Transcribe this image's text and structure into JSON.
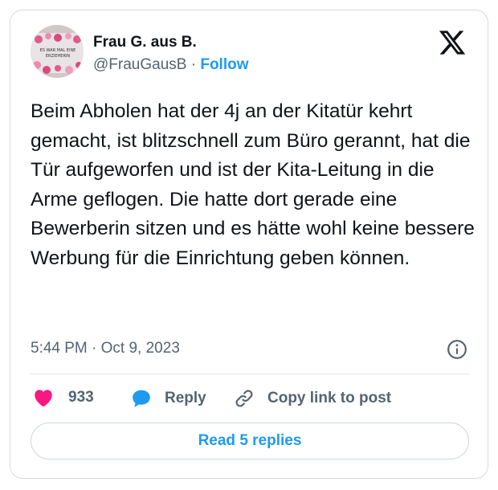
{
  "author": {
    "name": "Frau G. aus B.",
    "handle": "@FrauGausB",
    "separator": "·",
    "follow_label": "Follow",
    "avatar_caption_line1": "ES WAR MAL EINE",
    "avatar_caption_line2": "ERZIEHERIN"
  },
  "tweet": {
    "text": "Beim Abholen hat der 4j an der Kitatür kehrt gemacht, ist blitzschnell zum Büro gerannt, hat die Tür aufgeworfen und ist der Kita-Leitung in die Arme geflogen. Die hatte dort gerade eine Bewerberin sitzen und es hätte wohl keine bessere Werbung für die Einrichtung geben können.",
    "time": "5:44 PM",
    "separator": "·",
    "date": "Oct 9, 2023"
  },
  "actions": {
    "like_count": "933",
    "reply_label": "Reply",
    "copy_label": "Copy link to post"
  },
  "footer": {
    "read_replies_label": "Read 5 replies"
  },
  "colors": {
    "accent": "#1d9bf0",
    "like": "#f91880",
    "text": "#0f1419",
    "muted": "#536471"
  },
  "icons": {
    "logo": "x-logo-icon",
    "info": "info-icon",
    "like": "heart-icon",
    "reply": "speech-bubble-icon",
    "copy": "link-icon"
  }
}
